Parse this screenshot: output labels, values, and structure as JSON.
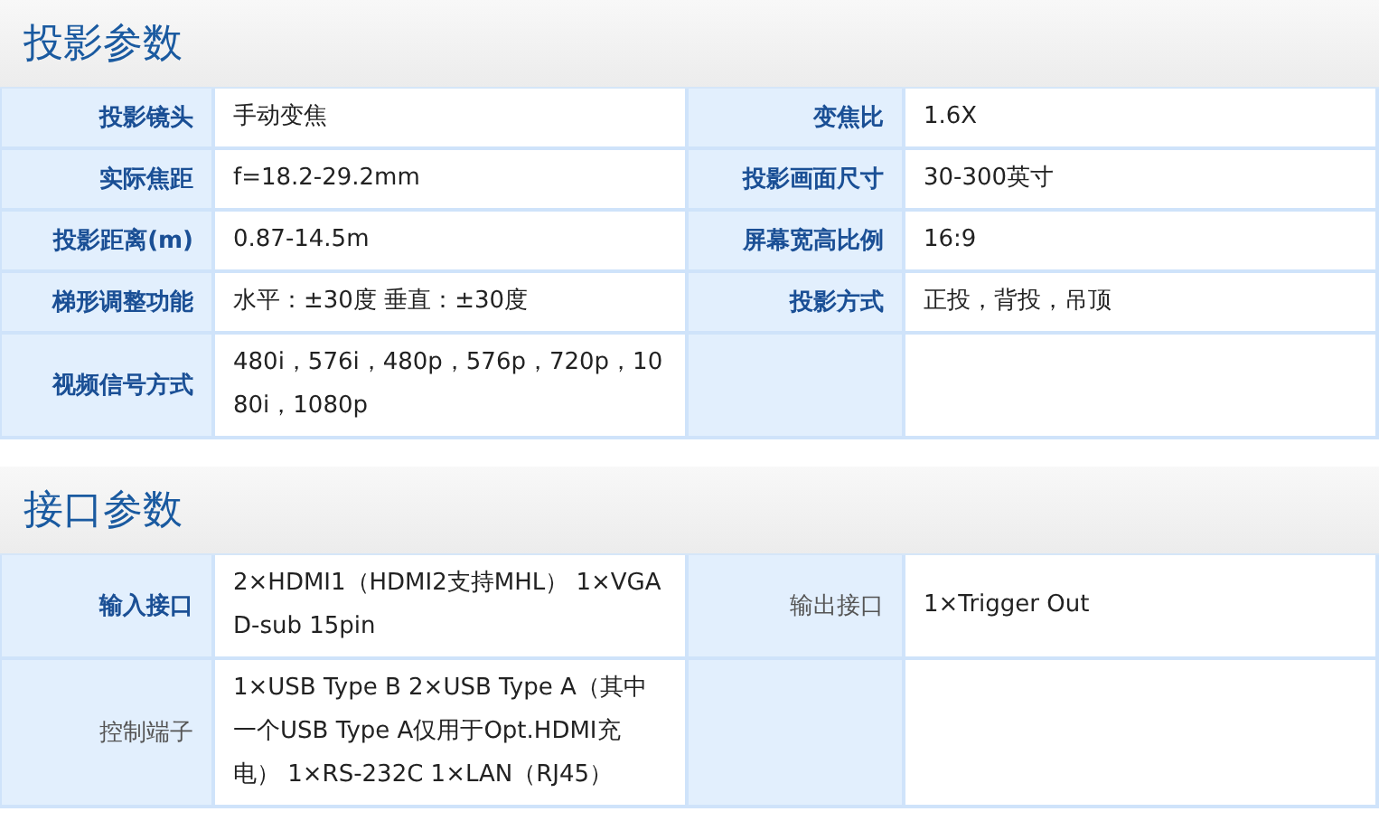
{
  "sections": [
    {
      "title": "投影参数",
      "rows": [
        [
          {
            "label": "投影镜头",
            "bold": true,
            "value": "手动变焦"
          },
          {
            "label": "变焦比",
            "bold": true,
            "value": "1.6X"
          }
        ],
        [
          {
            "label": "实际焦距",
            "bold": true,
            "value": "f=18.2-29.2mm"
          },
          {
            "label": "投影画面尺寸",
            "bold": true,
            "value": "30-300英寸"
          }
        ],
        [
          {
            "label": "投影距离(m)",
            "bold": true,
            "value": "0.87-14.5m"
          },
          {
            "label": "屏幕宽高比例",
            "bold": true,
            "value": "16:9"
          }
        ],
        [
          {
            "label": "梯形调整功能",
            "bold": true,
            "value": "水平：±30度 垂直：±30度"
          },
          {
            "label": "投影方式",
            "bold": true,
            "value": "正投，背投，吊顶"
          }
        ],
        [
          {
            "label": "视频信号方式",
            "bold": true,
            "value": "480i，576i，480p，576p，720p，1080i，1080p"
          },
          {}
        ]
      ]
    },
    {
      "title": "接口参数",
      "rows": [
        [
          {
            "label": "输入接口",
            "bold": true,
            "value": "2×HDMI1（HDMI2支持MHL） 1×VGA D-sub 15pin"
          },
          {
            "label": "输出接口",
            "bold": false,
            "value": "1×Trigger Out"
          }
        ],
        [
          {
            "label": "控制端子",
            "bold": false,
            "value": "1×USB Type B 2×USB Type A（其中一个USB Type A仅用于Opt.HDMI充电） 1×RS-232C 1×LAN（RJ45）"
          },
          {}
        ]
      ]
    }
  ]
}
